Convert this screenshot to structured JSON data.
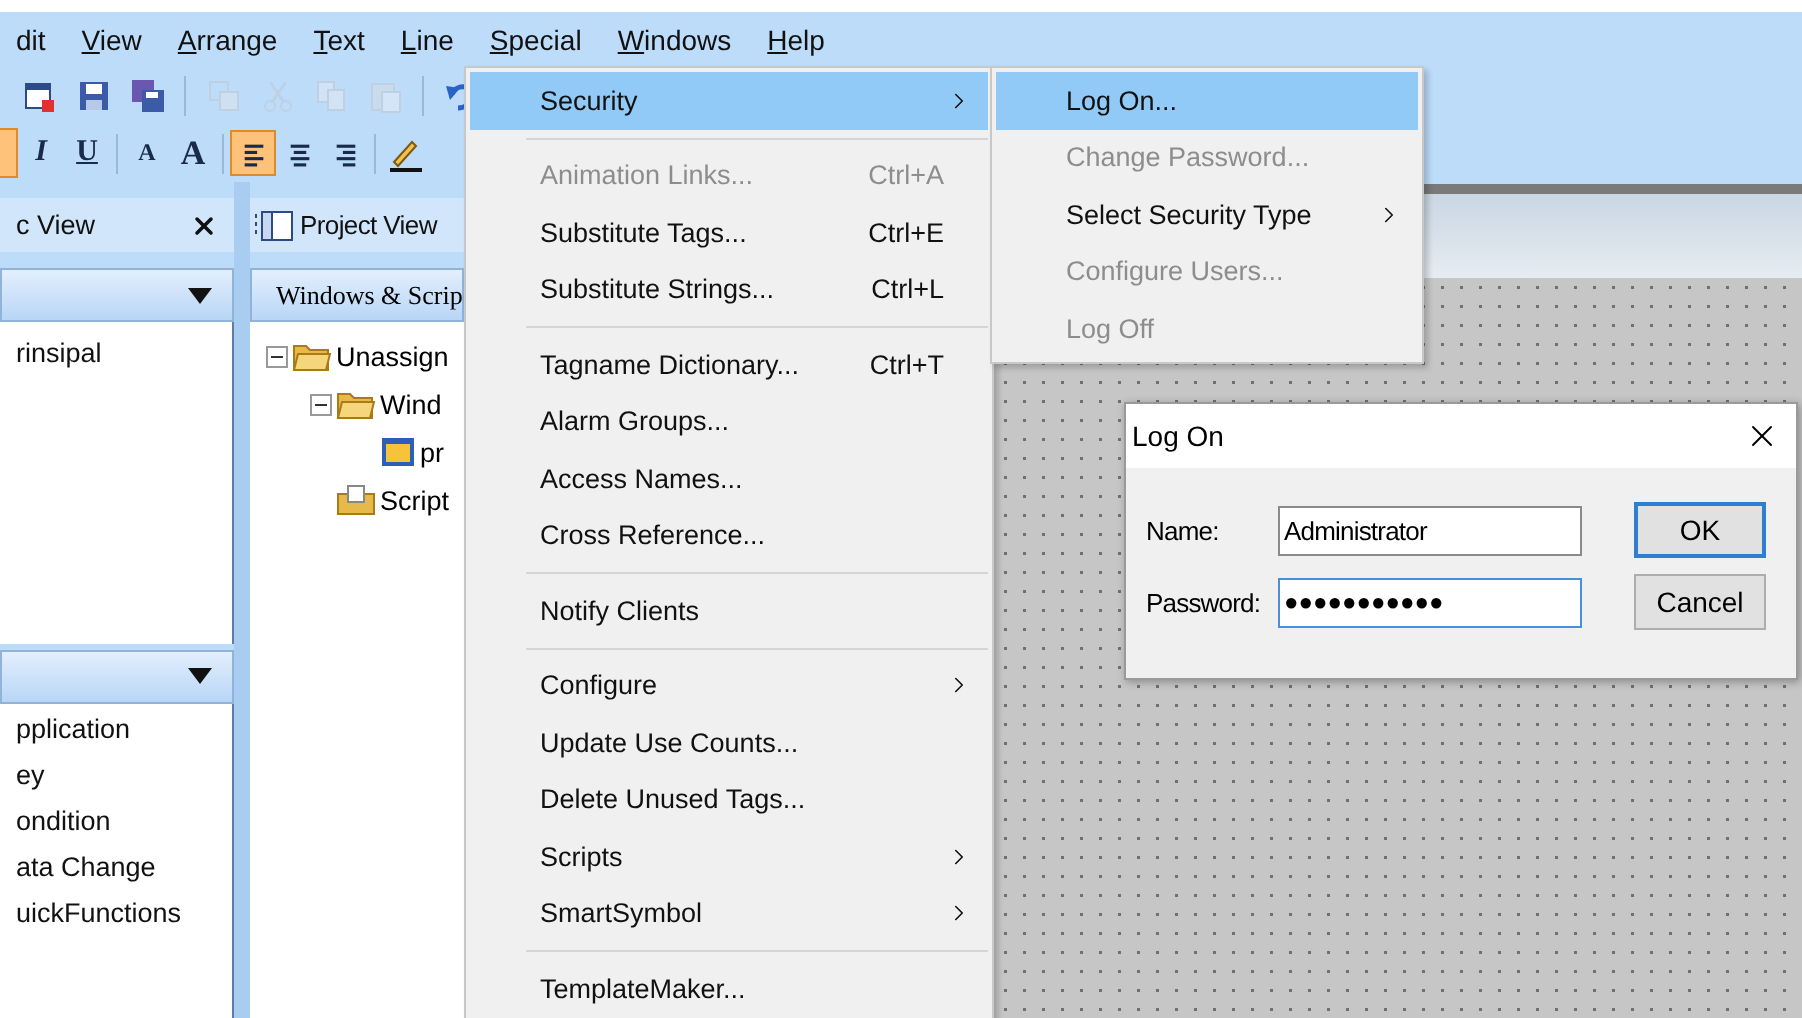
{
  "menubar": [
    {
      "label": "dit",
      "mnemonic": false
    },
    {
      "label": "View",
      "mnemonic": true
    },
    {
      "label": "Arrange",
      "mnemonic": true
    },
    {
      "label": "Text",
      "mnemonic": true
    },
    {
      "label": "Line",
      "mnemonic": true
    },
    {
      "label": "Special",
      "mnemonic": true
    },
    {
      "label": "Windows",
      "mnemonic": true
    },
    {
      "label": "Help",
      "mnemonic": true
    }
  ],
  "toolbar_top": [
    {
      "kind": "new",
      "disabled": false
    },
    {
      "kind": "save",
      "disabled": false
    },
    {
      "kind": "save-all",
      "disabled": false
    },
    {
      "kind": "separator"
    },
    {
      "kind": "duplicate",
      "disabled": true
    },
    {
      "kind": "cut",
      "disabled": true
    },
    {
      "kind": "copy",
      "disabled": true
    },
    {
      "kind": "paste",
      "disabled": true
    },
    {
      "kind": "separator"
    },
    {
      "kind": "undo",
      "disabled": false
    }
  ],
  "toolbar_format": [
    {
      "kind": "italic",
      "label": "I",
      "selected": false
    },
    {
      "kind": "underline",
      "label": "U",
      "selected": false
    },
    {
      "kind": "separator"
    },
    {
      "kind": "smaller",
      "label": "A",
      "selected": false
    },
    {
      "kind": "larger",
      "label": "A",
      "selected": false
    },
    {
      "kind": "separator"
    },
    {
      "kind": "align-left",
      "selected": true
    },
    {
      "kind": "align-center",
      "selected": false
    },
    {
      "kind": "align-right",
      "selected": false
    },
    {
      "kind": "separator"
    },
    {
      "kind": "pen"
    }
  ],
  "left_panel": {
    "title": "c View",
    "upper_items": [
      "rinsipal"
    ],
    "lower_items": [
      "pplication",
      "ey",
      "ondition",
      "ata Change",
      "uickFunctions"
    ]
  },
  "project_panel": {
    "title": "Project View",
    "tab": "Windows & Scrip",
    "tree": [
      {
        "label": "Unassign",
        "kind": "folder",
        "expanded": true,
        "children": [
          {
            "label": "Wind",
            "kind": "folder",
            "expanded": true,
            "children": [
              {
                "label": "pr",
                "kind": "window"
              }
            ]
          },
          {
            "label": "Script",
            "kind": "scripts"
          }
        ]
      }
    ]
  },
  "special_menu": [
    {
      "kind": "item",
      "label": "Security",
      "submenu": true,
      "selected": true,
      "disabled": false
    },
    {
      "kind": "separator"
    },
    {
      "kind": "item",
      "label": "Animation Links...",
      "shortcut": "Ctrl+A",
      "disabled": true,
      "selected": false
    },
    {
      "kind": "item",
      "label": "Substitute Tags...",
      "shortcut": "Ctrl+E",
      "disabled": false,
      "selected": false
    },
    {
      "kind": "item",
      "label": "Substitute Strings...",
      "shortcut": "Ctrl+L",
      "disabled": false,
      "selected": false
    },
    {
      "kind": "separator"
    },
    {
      "kind": "item",
      "label": "Tagname Dictionary...",
      "shortcut": "Ctrl+T",
      "disabled": false,
      "selected": false
    },
    {
      "kind": "item",
      "label": "Alarm Groups...",
      "disabled": false,
      "selected": false
    },
    {
      "kind": "item",
      "label": "Access Names...",
      "disabled": false,
      "selected": false
    },
    {
      "kind": "item",
      "label": "Cross Reference...",
      "disabled": false,
      "selected": false
    },
    {
      "kind": "separator"
    },
    {
      "kind": "item",
      "label": "Notify Clients",
      "disabled": false,
      "selected": false
    },
    {
      "kind": "separator"
    },
    {
      "kind": "item",
      "label": "Configure",
      "submenu": true,
      "disabled": false,
      "selected": false
    },
    {
      "kind": "item",
      "label": "Update Use Counts...",
      "disabled": false,
      "selected": false
    },
    {
      "kind": "item",
      "label": "Delete Unused Tags...",
      "disabled": false,
      "selected": false
    },
    {
      "kind": "item",
      "label": "Scripts",
      "submenu": true,
      "disabled": false,
      "selected": false
    },
    {
      "kind": "item",
      "label": "SmartSymbol",
      "submenu": true,
      "disabled": false,
      "selected": false
    },
    {
      "kind": "separator"
    },
    {
      "kind": "item",
      "label": "TemplateMaker...",
      "disabled": false,
      "selected": false
    }
  ],
  "security_menu": [
    {
      "kind": "item",
      "label": "Log On...",
      "selected": true,
      "disabled": false
    },
    {
      "kind": "item",
      "label": "Change Password...",
      "selected": false,
      "disabled": true
    },
    {
      "kind": "item",
      "label": "Select Security Type",
      "submenu": true,
      "selected": false,
      "disabled": false
    },
    {
      "kind": "item",
      "label": "Configure Users...",
      "selected": false,
      "disabled": true
    },
    {
      "kind": "item",
      "label": "Log Off",
      "selected": false,
      "disabled": true
    }
  ],
  "dialog": {
    "title": "Log On",
    "name_label": "Name:",
    "name_value": "Administrator",
    "password_label": "Password:",
    "password_value": "●●●●●●●●●●●",
    "buttons": [
      {
        "label": "OK",
        "default": true
      },
      {
        "label": "Cancel",
        "default": false
      }
    ]
  }
}
